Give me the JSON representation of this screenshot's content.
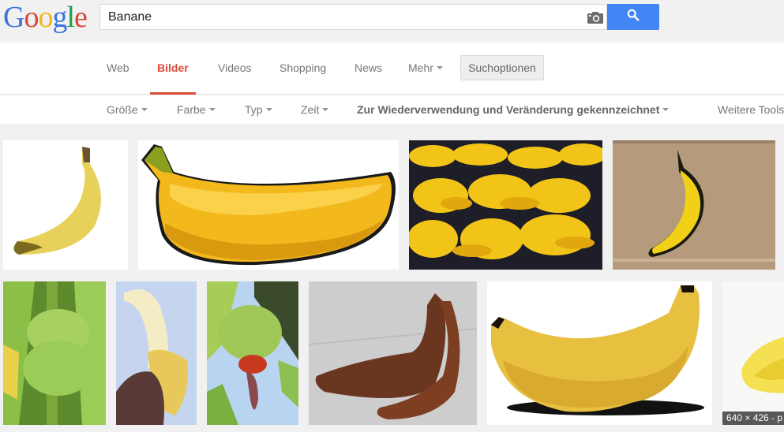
{
  "header": {
    "logo_letters": [
      {
        "char": "G",
        "color": "#3b74e0"
      },
      {
        "char": "o",
        "color": "#d9463b"
      },
      {
        "char": "o",
        "color": "#f3b612"
      },
      {
        "char": "g",
        "color": "#3b74e0"
      },
      {
        "char": "l",
        "color": "#1a9e4d"
      },
      {
        "char": "e",
        "color": "#d9463b"
      }
    ],
    "search_value": "Banane",
    "camera_icon": "camera-icon",
    "search_button_icon": "magnifier-icon",
    "accent_color": "#4285f4"
  },
  "nav": {
    "items": [
      {
        "label": "Web",
        "active": false
      },
      {
        "label": "Bilder",
        "active": true
      },
      {
        "label": "Videos",
        "active": false
      },
      {
        "label": "Shopping",
        "active": false
      },
      {
        "label": "News",
        "active": false
      },
      {
        "label": "Mehr",
        "active": false,
        "dropdown": true
      }
    ],
    "search_options_label": "Suchoptionen",
    "active_color": "#dd4b39"
  },
  "tools": {
    "items": [
      {
        "label": "Größe",
        "dropdown": true
      },
      {
        "label": "Farbe",
        "dropdown": true
      },
      {
        "label": "Typ",
        "dropdown": true
      },
      {
        "label": "Zeit",
        "dropdown": true
      },
      {
        "label": "Zur Wiederverwendung und Veränderung gekennzeichnet",
        "dropdown": true,
        "bold": true
      },
      {
        "label": "Weitere Tools",
        "dropdown": false
      }
    ]
  },
  "results": {
    "images": [
      {
        "description": "single yellow banana on white"
      },
      {
        "description": "cartoon banana clip art"
      },
      {
        "description": "many banana bunches at market"
      },
      {
        "description": "banana graffiti on wall"
      },
      {
        "description": "green banana bunch on tree"
      },
      {
        "description": "hand peeling banana against sky"
      },
      {
        "description": "banana plant with red flower"
      },
      {
        "description": "two red bananas on cloth"
      },
      {
        "description": "glossy yellow banana with shadow"
      },
      {
        "description": "bananas on white background"
      }
    ],
    "hover_dimension_label": "640 × 426 - p"
  }
}
